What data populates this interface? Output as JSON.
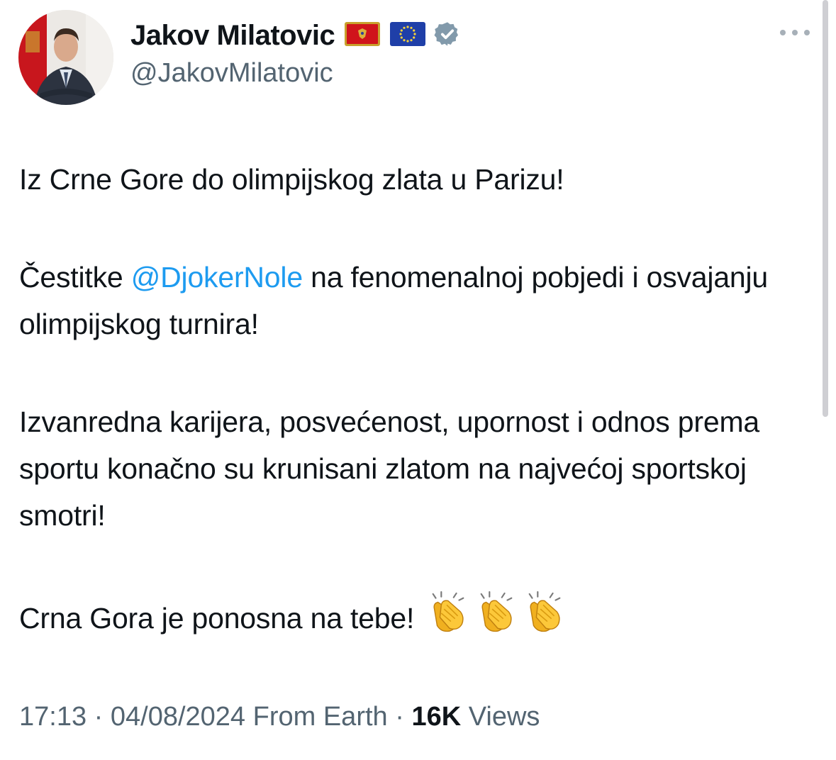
{
  "author": {
    "display_name": "Jakov Milatovic",
    "handle": "@JakovMilatovic",
    "flags": [
      "montenegro-flag",
      "eu-flag"
    ],
    "verified": true,
    "verified_color": "#829aab"
  },
  "menu": {
    "icon": "more-horizontal-icon"
  },
  "tweet": {
    "line1": "Iz Crne Gore do olimpijskog zlata u Parizu!",
    "para2_before": "Čestitke ",
    "mention": "@DjokerNole",
    "para2_after": " na fenomenalnoj pobjedi i osvajanju olimpijskog turnira!",
    "para3": "Izvanredna karijera, posvećenost, upornost i odnos prema sportu konačno su krunisani zlatom na najvećoj sportskoj smotri!",
    "para4": "Crna Gora je ponosna na tebe!",
    "emoji": [
      "clapping-hands",
      "clapping-hands",
      "clapping-hands"
    ]
  },
  "meta": {
    "time": "17:13",
    "separator": " · ",
    "date": "04/08/2024",
    "location": "From Earth",
    "views_count": "16K",
    "views_label": "Views"
  },
  "colors": {
    "mention": "#1d9bf0",
    "secondary_text": "#536471",
    "primary_text": "#0f1419"
  }
}
